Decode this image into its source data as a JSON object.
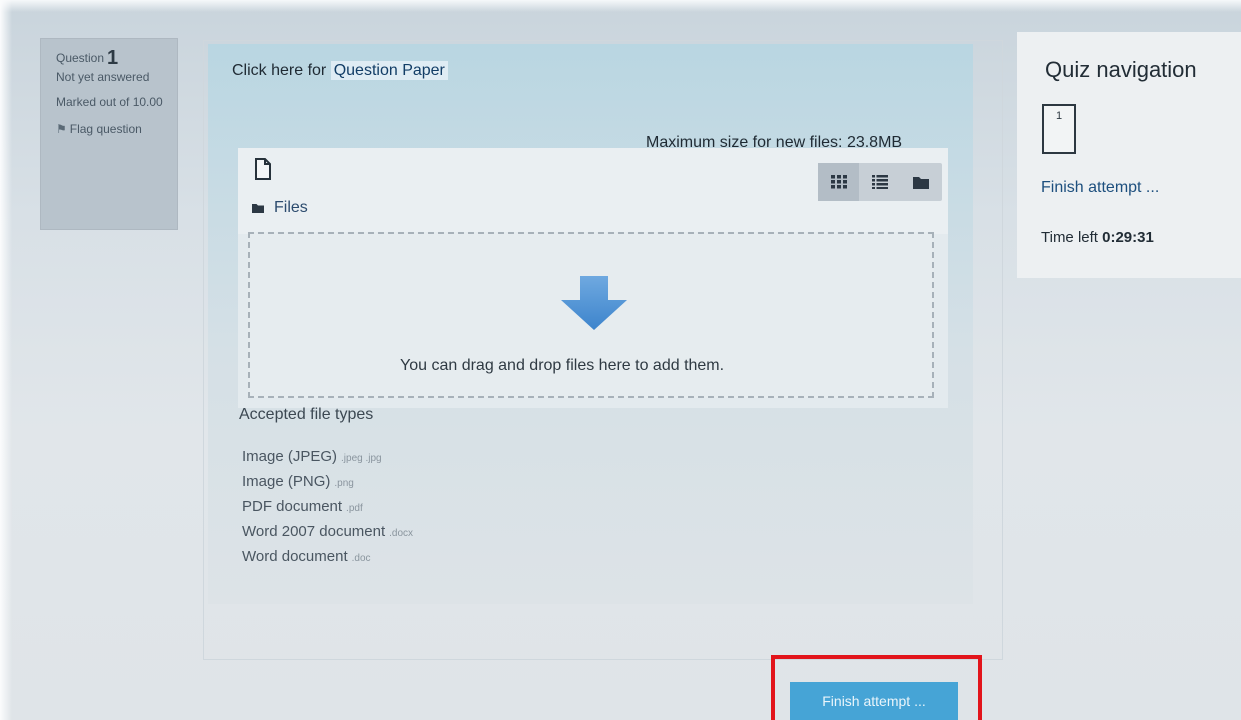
{
  "question_info": {
    "question_label": "Question",
    "question_number": "1",
    "state": "Not yet answered",
    "marks": "Marked out of 10.00",
    "flag_label": "Flag question"
  },
  "formulation": {
    "question_paper_prefix": "Click here for",
    "question_paper_link": "Question Paper",
    "max_size": "Maximum size for new files: 23.8MB",
    "files_path": "Files",
    "dropzone_text": "You can drag and drop files here to add them.",
    "accepted_title": "Accepted file types",
    "accepted_types": [
      {
        "name": "Image (JPEG)",
        "ext": ".jpeg .jpg"
      },
      {
        "name": "Image (PNG)",
        "ext": ".png"
      },
      {
        "name": "PDF document",
        "ext": ".pdf"
      },
      {
        "name": "Word 2007 document",
        "ext": ".docx"
      },
      {
        "name": "Word document",
        "ext": ".doc"
      }
    ]
  },
  "quiz_nav": {
    "title": "Quiz navigation",
    "question_button": "1",
    "finish_link": "Finish attempt ...",
    "time_left_label": "Time left",
    "time_left_value": "0:29:31"
  },
  "finish_button_label": "Finish attempt ...",
  "colors": {
    "accent_button": "#46a4d6",
    "highlight_box": "#e2141b",
    "link": "#1d4f7e"
  }
}
